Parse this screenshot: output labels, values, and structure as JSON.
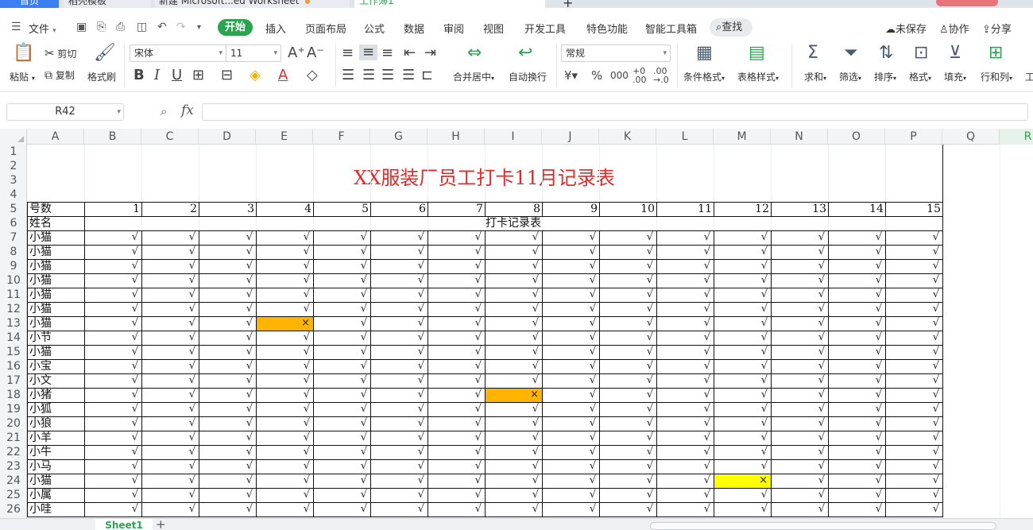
{
  "tabs": {
    "home": "首页",
    "templates": "稻壳模板",
    "workbook_other": "新建 Microsoft...ed Worksheet",
    "workbook_active": "工作簿1",
    "add": "+"
  },
  "menu": {
    "file": "文件",
    "items": [
      "开始",
      "插入",
      "页面布局",
      "公式",
      "数据",
      "审阅",
      "视图",
      "开发工具",
      "特色功能",
      "智能工具箱"
    ],
    "search": "查找",
    "unsaved": "未保存",
    "collab": "协作",
    "share": "分享"
  },
  "ribbon": {
    "paste": "粘贴",
    "cut": "剪切",
    "copy": "复制",
    "format_painter": "格式刷",
    "font_name": "宋体",
    "font_size": "11",
    "merge_center": "合并居中",
    "wrap_text": "自动换行",
    "number_format": "常规",
    "conditional_format": "条件格式",
    "table_style": "表格样式",
    "sum": "求和",
    "filter": "筛选",
    "sort": "排序",
    "format": "格式",
    "fill": "填充",
    "rows_cols": "行和列",
    "worksheet": "工"
  },
  "formula_bar": {
    "name_box": "R42",
    "fx": "fx"
  },
  "columns": [
    "A",
    "B",
    "C",
    "D",
    "E",
    "F",
    "G",
    "H",
    "I",
    "J",
    "K",
    "L",
    "M",
    "N",
    "O",
    "P",
    "Q",
    "R"
  ],
  "rows": [
    "1",
    "2",
    "3",
    "4",
    "5",
    "6",
    "7",
    "8",
    "9",
    "10",
    "11",
    "12",
    "13",
    "14",
    "15",
    "16",
    "17",
    "18",
    "19",
    "20",
    "21",
    "22",
    "23",
    "24",
    "25",
    "26"
  ],
  "sheet": {
    "title": "XX服装厂员工打卡11月记录表",
    "label_day": "号数",
    "label_name": "姓名",
    "sub_header": "打卡记录表",
    "days": [
      "1",
      "2",
      "3",
      "4",
      "5",
      "6",
      "7",
      "8",
      "9",
      "10",
      "11",
      "12",
      "13",
      "14",
      "15"
    ],
    "names": [
      "小猫",
      "小猫",
      "小猫",
      "小猫",
      "小猫",
      "小猫",
      "小猫",
      "小节",
      "小猫",
      "小宝",
      "小文",
      "小猪",
      "小狐",
      "小狼",
      "小羊",
      "小牛",
      "小马",
      "小猫",
      "小属",
      "小哇"
    ],
    "check_symbol": "√",
    "absent_symbol": "×",
    "absences": [
      {
        "row": 6,
        "day": 4,
        "color": "#ffb400"
      },
      {
        "row": 11,
        "day": 8,
        "color": "#ffb400"
      },
      {
        "row": 17,
        "day": 12,
        "color": "#ffff00"
      }
    ]
  },
  "sheet_tabs": [
    "Sheet1"
  ],
  "colors": {
    "accent_green": "#2aa44f",
    "title_red": "#e12b2b",
    "orange_fill": "#ffb400",
    "yellow_fill": "#ffff00"
  }
}
